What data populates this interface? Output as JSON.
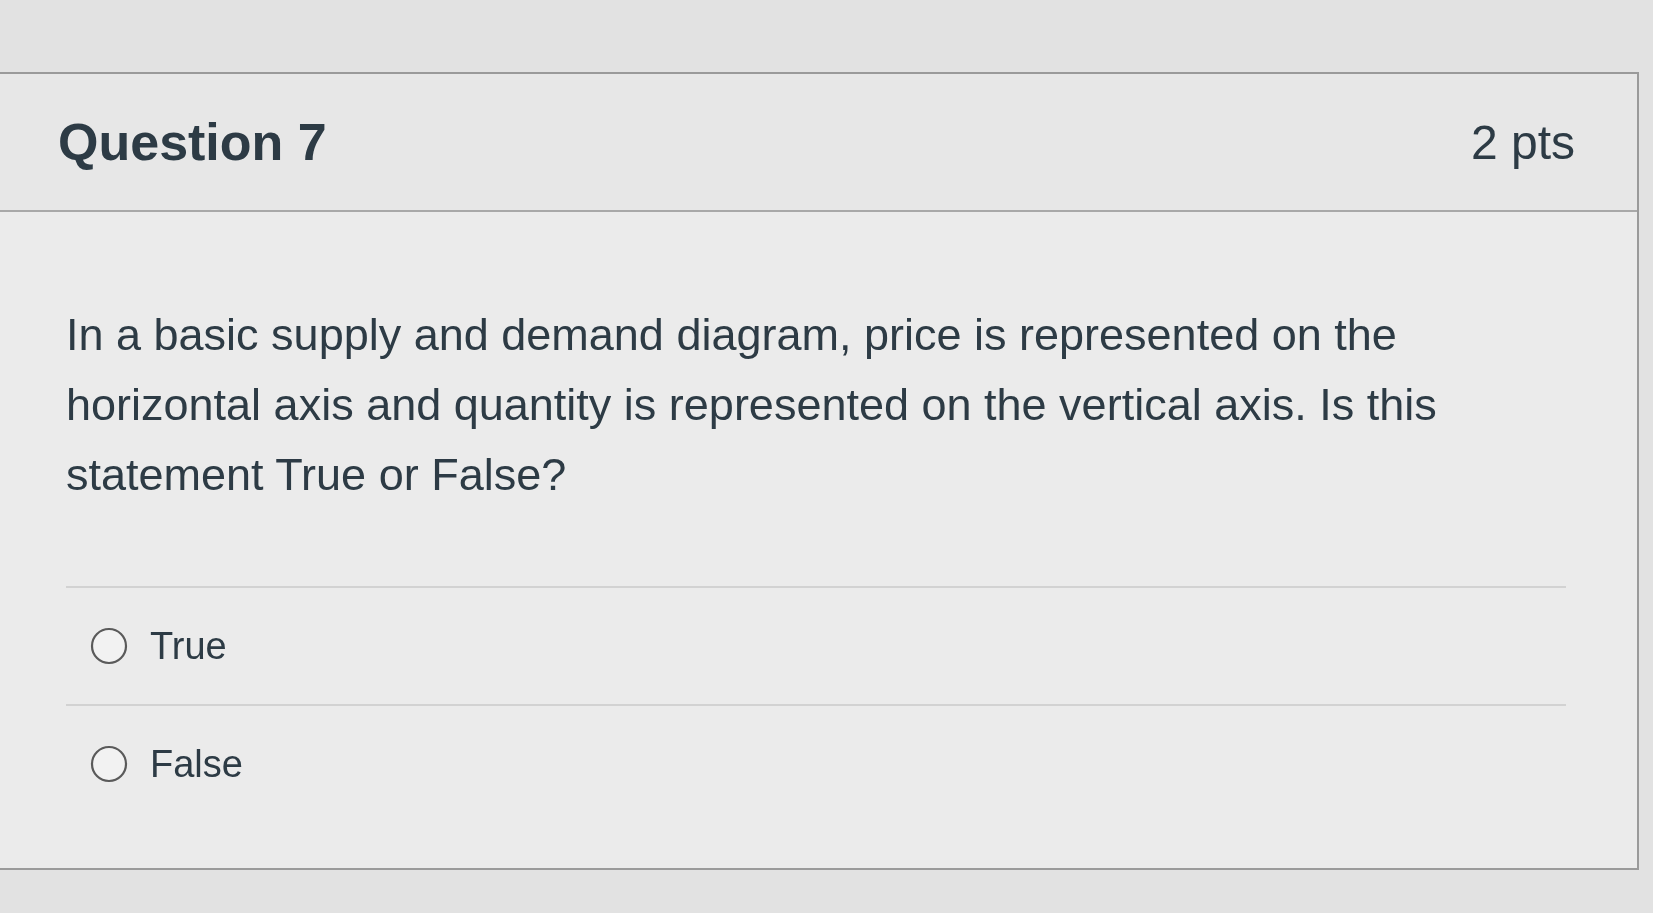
{
  "question": {
    "title": "Question 7",
    "points": "2 pts",
    "text": "In a basic supply and demand diagram, price is represented on the horizontal axis and quantity is represented on the vertical axis. Is this statement True or False?"
  },
  "answers": [
    {
      "label": "True",
      "selected": false
    },
    {
      "label": "False",
      "selected": false
    }
  ]
}
